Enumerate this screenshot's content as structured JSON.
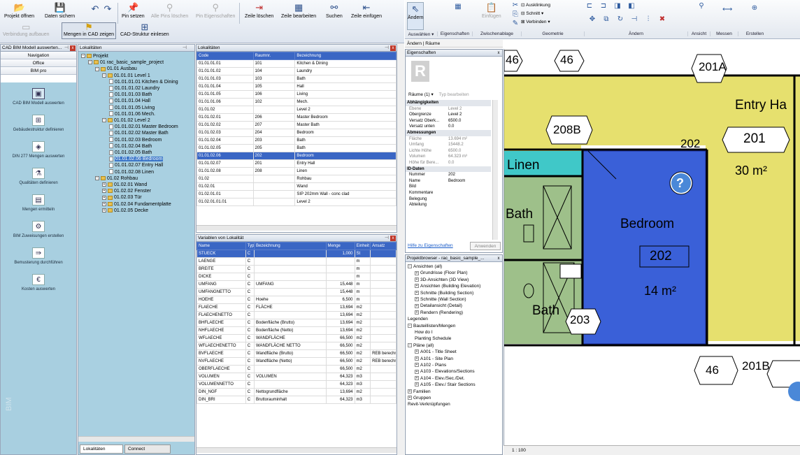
{
  "left_ribbon": {
    "row1": [
      {
        "name": "open-project-button",
        "label": "Projekt öffnen",
        "icon": "folder-open-icon"
      },
      {
        "name": "save-data-button",
        "label": "Daten sichern",
        "icon": "save-icon"
      },
      {
        "name": "undo-button",
        "label": "",
        "icon": "undo-icon"
      },
      {
        "name": "redo-button",
        "label": "",
        "icon": "redo-icon"
      },
      {
        "name": "set-pin-button",
        "label": "Pin setzen",
        "icon": "pin-icon"
      },
      {
        "name": "delete-all-pins-button",
        "label": "Alle Pins löschen",
        "icon": "pin-delete-icon"
      },
      {
        "name": "pin-properties-button",
        "label": "Pin Eigenschaften",
        "icon": "pin-properties-icon"
      },
      {
        "name": "delete-row-button",
        "label": "Zeile löschen",
        "icon": "row-delete-icon"
      },
      {
        "name": "edit-row-button",
        "label": "Zeile bearbeiten",
        "icon": "row-edit-icon"
      },
      {
        "name": "search-button",
        "label": "Suchen",
        "icon": "binoculars-icon"
      },
      {
        "name": "insert-row-button",
        "label": "Zeile einfügen",
        "icon": "row-insert-icon"
      }
    ],
    "row2": [
      {
        "name": "connect-button",
        "label": "Verbindung aufbauen",
        "icon": "connect-icon"
      },
      {
        "name": "show-in-cad-button",
        "label": "Mengen in CAD zeigen",
        "icon": "cad-show-icon"
      },
      {
        "name": "import-cad-structure-button",
        "label": "CAD-Struktur einlesen",
        "icon": "cad-import-icon"
      }
    ]
  },
  "bim_panel": {
    "title": "CAD BIM Modell auswerten...",
    "nav": [
      "Navigation",
      "Office",
      "BIM pro"
    ],
    "tools": [
      {
        "label": "CAD BIM Modell auswerten",
        "icon": "bim-model-icon"
      },
      {
        "label": "Gebäudestruktur definieren",
        "icon": "building-structure-icon"
      },
      {
        "label": "DIN 277 Mengen auswerten",
        "icon": "din277-icon"
      },
      {
        "label": "Qualitäten definieren",
        "icon": "qualities-icon"
      },
      {
        "label": "Mengen ermitteln",
        "icon": "quantities-icon"
      },
      {
        "label": "BIM Zuweisungen erstellen",
        "icon": "bim-assign-icon"
      },
      {
        "label": "Bemusterung durchführen",
        "icon": "sampling-icon"
      },
      {
        "label": "Kosten auswerten",
        "icon": "costs-icon"
      }
    ],
    "side_label": "BIM"
  },
  "tree": {
    "nodes": [
      {
        "label": "Projekt",
        "level": 0,
        "kind": "folder",
        "exp": "−"
      },
      {
        "label": "01 rac_basic_sample_project",
        "level": 1,
        "kind": "folder",
        "exp": "−"
      },
      {
        "label": "01.01 Ausbau",
        "level": 2,
        "kind": "folder",
        "exp": "−"
      },
      {
        "label": "01.01.01 Level 1",
        "level": 3,
        "kind": "folder",
        "exp": "−"
      },
      {
        "label": "01.01.01.01 Kitchen & Dining",
        "level": 4,
        "kind": "doc"
      },
      {
        "label": "01.01.01.02 Laundry",
        "level": 4,
        "kind": "doc"
      },
      {
        "label": "01.01.01.03 Bath",
        "level": 4,
        "kind": "doc"
      },
      {
        "label": "01.01.01.04 Hall",
        "level": 4,
        "kind": "doc"
      },
      {
        "label": "01.01.01.05 Living",
        "level": 4,
        "kind": "doc"
      },
      {
        "label": "01.01.01.06 Mech.",
        "level": 4,
        "kind": "doc"
      },
      {
        "label": "01.01.02 Level 2",
        "level": 3,
        "kind": "folder",
        "exp": "−"
      },
      {
        "label": "01.01.02.01 Master Bedroom",
        "level": 4,
        "kind": "doc"
      },
      {
        "label": "01.01.02.02 Master Bath",
        "level": 4,
        "kind": "doc"
      },
      {
        "label": "01.01.02.03 Bedroom",
        "level": 4,
        "kind": "doc"
      },
      {
        "label": "01.01.02.04 Bath",
        "level": 4,
        "kind": "doc"
      },
      {
        "label": "01.01.02.05 Bath",
        "level": 4,
        "kind": "doc"
      },
      {
        "label": "01.01.02.06 Bedroom",
        "level": 4,
        "kind": "doc",
        "selected": true
      },
      {
        "label": "01.01.02.07 Entry Hall",
        "level": 4,
        "kind": "doc"
      },
      {
        "label": "01.01.02.08 Linen",
        "level": 4,
        "kind": "doc"
      },
      {
        "label": "01.02 Rohbau",
        "level": 2,
        "kind": "folder",
        "exp": "−"
      },
      {
        "label": "01.02.01 Wand",
        "level": 3,
        "kind": "folder",
        "exp": "+"
      },
      {
        "label": "01.02.02 Fenster",
        "level": 3,
        "kind": "folder",
        "exp": "+"
      },
      {
        "label": "01.02.03 Tür",
        "level": 3,
        "kind": "folder",
        "exp": "+"
      },
      {
        "label": "01.02.04 Fundamentplatte",
        "level": 3,
        "kind": "folder",
        "exp": "+"
      },
      {
        "label": "01.02.05 Decke",
        "level": 3,
        "kind": "folder",
        "exp": "+"
      }
    ],
    "tabs": [
      "Lokalitäten",
      "Connect"
    ]
  },
  "localities": {
    "title": "Lokalitäten",
    "columns": [
      "Code",
      "Raumnr.",
      "Bezeichnung"
    ],
    "rows": [
      [
        "01.01.01.01",
        "101",
        "Kitchen & Dining"
      ],
      [
        "01.01.01.02",
        "104",
        "Laundry"
      ],
      [
        "01.01.01.03",
        "103",
        "Bath"
      ],
      [
        "01.01.01.04",
        "105",
        "Hall"
      ],
      [
        "01.01.01.05",
        "106",
        "Living"
      ],
      [
        "01.01.01.06",
        "102",
        "Mech."
      ],
      [
        "01.01.02",
        "",
        "Level 2"
      ],
      [
        "01.01.02.01",
        "206",
        "Master Bedroom"
      ],
      [
        "01.01.02.02",
        "207",
        "Master Bath"
      ],
      [
        "01.01.02.03",
        "204",
        "Bedroom"
      ],
      [
        "01.01.02.04",
        "203",
        "Bath"
      ],
      [
        "01.01.02.05",
        "205",
        "Bath"
      ],
      [
        "01.01.02.06",
        "202",
        "Bedroom"
      ],
      [
        "01.01.02.07",
        "201",
        "Entry Hall"
      ],
      [
        "01.01.02.08",
        "208",
        "Linen"
      ],
      [
        "01.02",
        "",
        "Rohbau"
      ],
      [
        "01.02.01",
        "",
        "Wand"
      ],
      [
        "01.02.01.01",
        "",
        "SIP 202mm Wall - conc clad"
      ],
      [
        "01.02.01.01.01",
        "",
        "Level 2"
      ]
    ],
    "selected_row": 12
  },
  "variables": {
    "title": "Variablen von Lokalität",
    "columns": [
      "Name",
      "Typ",
      "Bezeichnung",
      "Menge",
      "Einheit",
      "Ansatz"
    ],
    "rows": [
      [
        "STUECK",
        "C",
        "",
        "1,000",
        "St",
        ""
      ],
      [
        "LAENGE",
        "C",
        "",
        "",
        "m",
        ""
      ],
      [
        "BREITE",
        "C",
        "",
        "",
        "m",
        ""
      ],
      [
        "DICKE",
        "C",
        "",
        "",
        "m",
        ""
      ],
      [
        "UMFANG",
        "C",
        "UMFANG",
        "15,448",
        "m",
        ""
      ],
      [
        "UMFANGNETTO",
        "C",
        "",
        "15,448",
        "m",
        ""
      ],
      [
        "HOEHE",
        "C",
        "Hoehe",
        "6,500",
        "m",
        ""
      ],
      [
        "FLAECHE",
        "C",
        "FLÄCHE",
        "13,694",
        "m2",
        ""
      ],
      [
        "FLAECHENETTO",
        "C",
        "",
        "13,694",
        "m2",
        ""
      ],
      [
        "BHFLAECHE",
        "C",
        "Bodenfläche (Brutto)",
        "13,694",
        "m2",
        ""
      ],
      [
        "NHFLAECHE",
        "C",
        "Bodenfläche (Netto)",
        "13,694",
        "m2",
        ""
      ],
      [
        "WFLAECHE",
        "C",
        "WANDFLÄCHE",
        "66,500",
        "m2",
        ""
      ],
      [
        "WFLAECHENETTO",
        "C",
        "WANDFLÄCHE NETTO",
        "66,500",
        "m2",
        ""
      ],
      [
        "BVFLAECHE",
        "C",
        "Wandfläche (Brutto)",
        "66,500",
        "m2",
        "REB berechnet"
      ],
      [
        "NVFLAECHE",
        "C",
        "Wandfläche (Netto)",
        "66,500",
        "m2",
        "REB berechnet"
      ],
      [
        "OBERFLAECHE",
        "C",
        "",
        "66,500",
        "m2",
        ""
      ],
      [
        "VOLUMEN",
        "C",
        "VOLUMEN",
        "64,323",
        "m3",
        ""
      ],
      [
        "VOLUMENNETTO",
        "C",
        "",
        "64,323",
        "m3",
        ""
      ],
      [
        "DIN_NGF",
        "C",
        "Nettogrundfläche",
        "13,694",
        "m2",
        ""
      ],
      [
        "DIN_BRI",
        "C",
        "Bruttorauminhalt",
        "64,323",
        "m3",
        ""
      ]
    ],
    "selected_row": 0
  },
  "revit_ribbon": {
    "groups": [
      {
        "label": "Auswählen ▾"
      },
      {
        "label": "Eigenschaften"
      },
      {
        "label": "Zwischenablage"
      },
      {
        "label": "Geometrie"
      },
      {
        "label": "Ändern"
      },
      {
        "label": "Ansicht"
      },
      {
        "label": "Messen"
      },
      {
        "label": "Erstellen"
      }
    ],
    "modify_label": "Ändern",
    "insert_label": "Einfügen",
    "cutback_label": "Ausklinkung",
    "cut_label": "Schnitt",
    "join_label": "Verbinden",
    "context": "Ändern | Räume"
  },
  "properties": {
    "title": "Eigenschaften",
    "type_selector": "Räume (1)",
    "edit_type": "Typ bearbeiten",
    "rows": [
      {
        "k": "Abhängigkeiten",
        "v": "",
        "cat": true
      },
      {
        "k": "Ebene",
        "v": "Level 2",
        "dim": true
      },
      {
        "k": "Obergrenze",
        "v": "Level 2"
      },
      {
        "k": "Versatz Oberk...",
        "v": "6500.0"
      },
      {
        "k": "Versatz unten",
        "v": "0.0"
      },
      {
        "k": "Abmessungen",
        "v": "",
        "cat": true
      },
      {
        "k": "Fläche",
        "v": "13.694 m²",
        "dim": true
      },
      {
        "k": "Umfang",
        "v": "15448.2",
        "dim": true
      },
      {
        "k": "Lichte Höhe",
        "v": "6500.0",
        "dim": true
      },
      {
        "k": "Volumen",
        "v": "64.323 m³",
        "dim": true
      },
      {
        "k": "Höhe für Bere...",
        "v": "0.0",
        "dim": true
      },
      {
        "k": "ID-Daten",
        "v": "",
        "cat": true
      },
      {
        "k": "Nummer",
        "v": "202"
      },
      {
        "k": "Name",
        "v": "Bedroom"
      },
      {
        "k": "Bild",
        "v": ""
      },
      {
        "k": "Kommentare",
        "v": ""
      },
      {
        "k": "Belegung",
        "v": ""
      },
      {
        "k": "Abteilung",
        "v": ""
      }
    ],
    "help_link": "Hilfe zu Eigenschaften",
    "apply": "Anwenden"
  },
  "project_browser": {
    "title": "Projektbrowser - rac_basic_sample_...",
    "items": [
      {
        "label": "Ansichten (all)",
        "level": 0,
        "exp": "−"
      },
      {
        "label": "Grundrisse (Floor Plan)",
        "level": 1,
        "exp": "+"
      },
      {
        "label": "3D-Ansichten (3D View)",
        "level": 1,
        "exp": "+"
      },
      {
        "label": "Ansichten (Building Elevation)",
        "level": 1,
        "exp": "+"
      },
      {
        "label": "Schnitte (Building Section)",
        "level": 1,
        "exp": "+"
      },
      {
        "label": "Schnitte (Wall Section)",
        "level": 1,
        "exp": "+"
      },
      {
        "label": "Detailansicht (Detail)",
        "level": 1,
        "exp": "+"
      },
      {
        "label": "Rendern (Rendering)",
        "level": 1,
        "exp": "+"
      },
      {
        "label": "Legenden",
        "level": 0,
        "exp": ""
      },
      {
        "label": "Bauteillisten/Mengen",
        "level": 0,
        "exp": "−"
      },
      {
        "label": "How do I",
        "level": 1,
        "exp": ""
      },
      {
        "label": "Planting Schedule",
        "level": 1,
        "exp": ""
      },
      {
        "label": "Pläne (all)",
        "level": 0,
        "exp": "−"
      },
      {
        "label": "A001 - Title Sheet",
        "level": 1,
        "exp": "+"
      },
      {
        "label": "A101 - Site Plan",
        "level": 1,
        "exp": "+"
      },
      {
        "label": "A102 - Plans",
        "level": 1,
        "exp": "+"
      },
      {
        "label": "A103 - Elevations/Sections",
        "level": 1,
        "exp": "+"
      },
      {
        "label": "A104 - Elev./Sec./Det.",
        "level": 1,
        "exp": "+"
      },
      {
        "label": "A105 - Elev./ Stair Sections",
        "level": 1,
        "exp": "+"
      },
      {
        "label": "Familien",
        "level": 0,
        "exp": "+"
      },
      {
        "label": "Gruppen",
        "level": 0,
        "exp": "+"
      },
      {
        "label": "Revit-Verknüpfungen",
        "level": 0,
        "exp": ""
      }
    ]
  },
  "plan": {
    "room_tags": {
      "t46a": "46",
      "t46b": "46",
      "t46c": "46",
      "t201a": "201A",
      "t201b": "201B",
      "t208b": "208B",
      "t202c": "202",
      "t201": "201",
      "t203": "203"
    },
    "rooms": {
      "entry": "Entry Ha",
      "entry_area": "30 m²",
      "linen": "Linen",
      "bath1": "Bath",
      "bath2": "Bath",
      "bedroom": "Bedroom",
      "bedroom_num": "202",
      "bedroom_area": "14 m²"
    },
    "help_mark": "?"
  },
  "status": {
    "scale": "1 : 100"
  },
  "colors": {
    "entry": "#e6e06e",
    "linen": "#40c8c8",
    "bath": "#9ec08a",
    "bedroom": "#3a60d8",
    "accent": "#3a66c4"
  }
}
